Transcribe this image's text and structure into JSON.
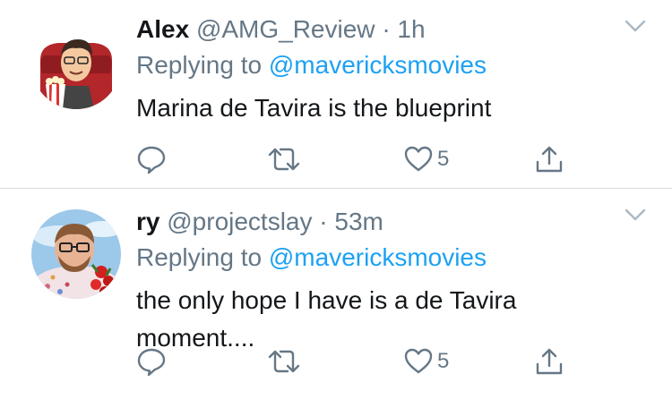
{
  "tweets": [
    {
      "name": "Alex",
      "handle": "@AMG_Review",
      "separator": "·",
      "time": "1h",
      "replying_prefix": "Replying to",
      "replying_to": "@mavericksmovies",
      "text": "Marina de Tavira is the blueprint",
      "like_count": "5",
      "avatar_icon": "bitmoji-popcorn-avatar"
    },
    {
      "name": "ry",
      "handle": "@projectslay",
      "separator": "·",
      "time": "53m",
      "replying_prefix": "Replying to",
      "replying_to": "@mavericksmovies",
      "text": "the only hope I have is a de Tavira moment....",
      "like_count": "5",
      "avatar_icon": "user-photo-avatar"
    }
  ],
  "colors": {
    "link": "#1da1f2",
    "secondary_text": "#657786",
    "primary_text": "#14171a",
    "divider": "#d6dce1"
  },
  "icons": [
    "chevron-down-icon",
    "reply-icon",
    "retweet-icon",
    "like-icon",
    "share-icon"
  ]
}
